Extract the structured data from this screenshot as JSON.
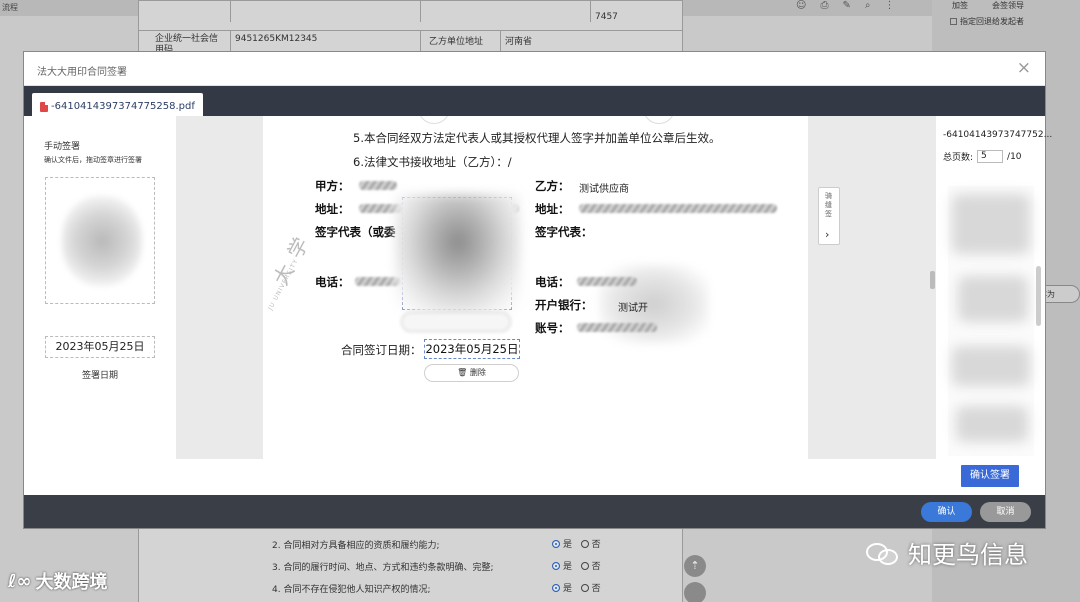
{
  "background": {
    "top_bar_text": "流程",
    "toolbar_right": [
      "加签",
      "会签领导",
      "指定回退给发起者"
    ],
    "table_rows": [
      {
        "label": "",
        "value": "",
        "side_label": "",
        "side_value": "7457"
      },
      {
        "label": "企业统一社会信用码",
        "value": "9451265KM12345",
        "side_label": "乙方单位地址",
        "side_value": "河南省"
      }
    ],
    "questions": [
      "2. 合同相对方具备相应的资质和履约能力;",
      "3. 合同的履行时间、地点、方式和违约条款明确、完整;",
      "4. 合同不存在侵犯他人知识产权的情况;"
    ],
    "radio_yes": "是",
    "radio_no": "否",
    "save_as_label": "存为",
    "checkbox_label": "指定回退给发起者"
  },
  "modal": {
    "title": "法大大用印合同签署",
    "close_glyph": "×",
    "tab_label": "-6410414397374775258.pdf",
    "left_panel": {
      "title": "手动签署",
      "hint": "确认文件后，拖动签章进行签署",
      "date_value": "2023年05月25日",
      "date_label": "签署日期"
    },
    "document": {
      "clause5": "5.本合同经双方法定代表人或其授权代理人签字并加盖单位公章后生效。",
      "clause6": "6.法律文书接收地址（乙方）：/",
      "party_a_label": "甲方：",
      "party_b_label": "乙方：",
      "party_b_value": "测试供应商",
      "address_label": "地址：",
      "address_label_b": "地址：",
      "sign_rep_a": "签字代表（或委",
      "sign_rep_b": "签字代表：",
      "phone_label_a": "电话：",
      "phone_label_b": "电话：",
      "bank_label": "开户银行：",
      "bank_value": "测试开",
      "account_label": "账号：",
      "sign_date_label": "合同签订日期：",
      "sign_date_value": "2023年05月25日",
      "delete_label": "删除",
      "watermark_text": "大 学",
      "watermark_small": "JU UNIVERSITY"
    },
    "seam_button": {
      "label": "骑缝签",
      "arrow": "›"
    },
    "right_panel": {
      "file_name": "-64104143973747752...",
      "pages_label": "总页数:",
      "current_page": "5",
      "total_pages": "/10"
    },
    "confirm_sign_label": "确认签署",
    "ok_label": "确认",
    "cancel_label": "取消"
  },
  "captions": {
    "wechat_account": "知更鸟信息",
    "corner_brand": "大数跨境"
  },
  "colors": {
    "primary": "#3a6ad8",
    "tab_bar": "#333a45",
    "footer": "#3a3f47"
  }
}
